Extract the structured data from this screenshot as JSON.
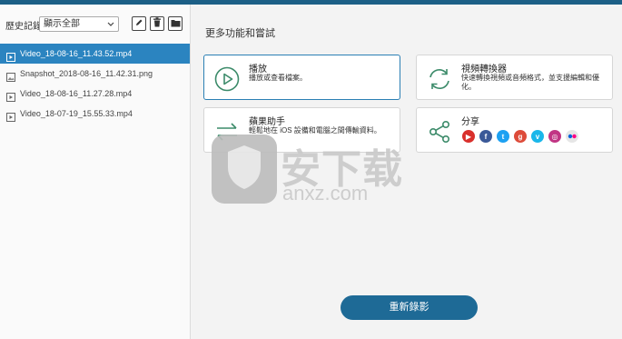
{
  "sidebar": {
    "history_label": "歷史記錄",
    "filter": {
      "selected": "顯示全部"
    },
    "files": [
      {
        "name": "Video_18-08-16_11.43.52.mp4",
        "kind": "video",
        "selected": true
      },
      {
        "name": "Snapshot_2018-08-16_11.42.31.png",
        "kind": "image",
        "selected": false
      },
      {
        "name": "Video_18-08-16_11.27.28.mp4",
        "kind": "video",
        "selected": false
      },
      {
        "name": "Video_18-07-19_15.55.33.mp4",
        "kind": "video",
        "selected": false
      }
    ]
  },
  "main": {
    "section_title": "更多功能和嘗試",
    "cards": {
      "play": {
        "title": "播放",
        "desc": "播放或查看檔案。"
      },
      "converter": {
        "title": "視頻轉換器",
        "desc": "快速轉換視頻或音頻格式，並支援編輯和優化。"
      },
      "apple": {
        "title": "蘋果助手",
        "desc": "輕鬆地在 iOS 設備和電腦之間傳輸資料。"
      },
      "share": {
        "title": "分享"
      }
    },
    "share_services": [
      {
        "name": "youtube-icon",
        "glyph": "▶",
        "color": "#d9302c"
      },
      {
        "name": "facebook-icon",
        "glyph": "f",
        "color": "#3b5998"
      },
      {
        "name": "twitter-icon",
        "glyph": "t",
        "color": "#1da1f2"
      },
      {
        "name": "google-plus-icon",
        "glyph": "g",
        "color": "#dd4b39"
      },
      {
        "name": "vimeo-icon",
        "glyph": "v",
        "color": "#1ab7ea"
      },
      {
        "name": "instagram-icon",
        "glyph": "◎",
        "color": "#c13584"
      },
      {
        "name": "flickr-icon",
        "glyph": "••",
        "color": "#e6e6e6"
      }
    ],
    "record_again": "重新錄影"
  },
  "watermark": {
    "chars": "安下载",
    "domain": "anxz.com"
  },
  "colors": {
    "accent": "#2b84c0",
    "dark_accent": "#1e6a96",
    "icon_green": "#3c8b6a"
  }
}
